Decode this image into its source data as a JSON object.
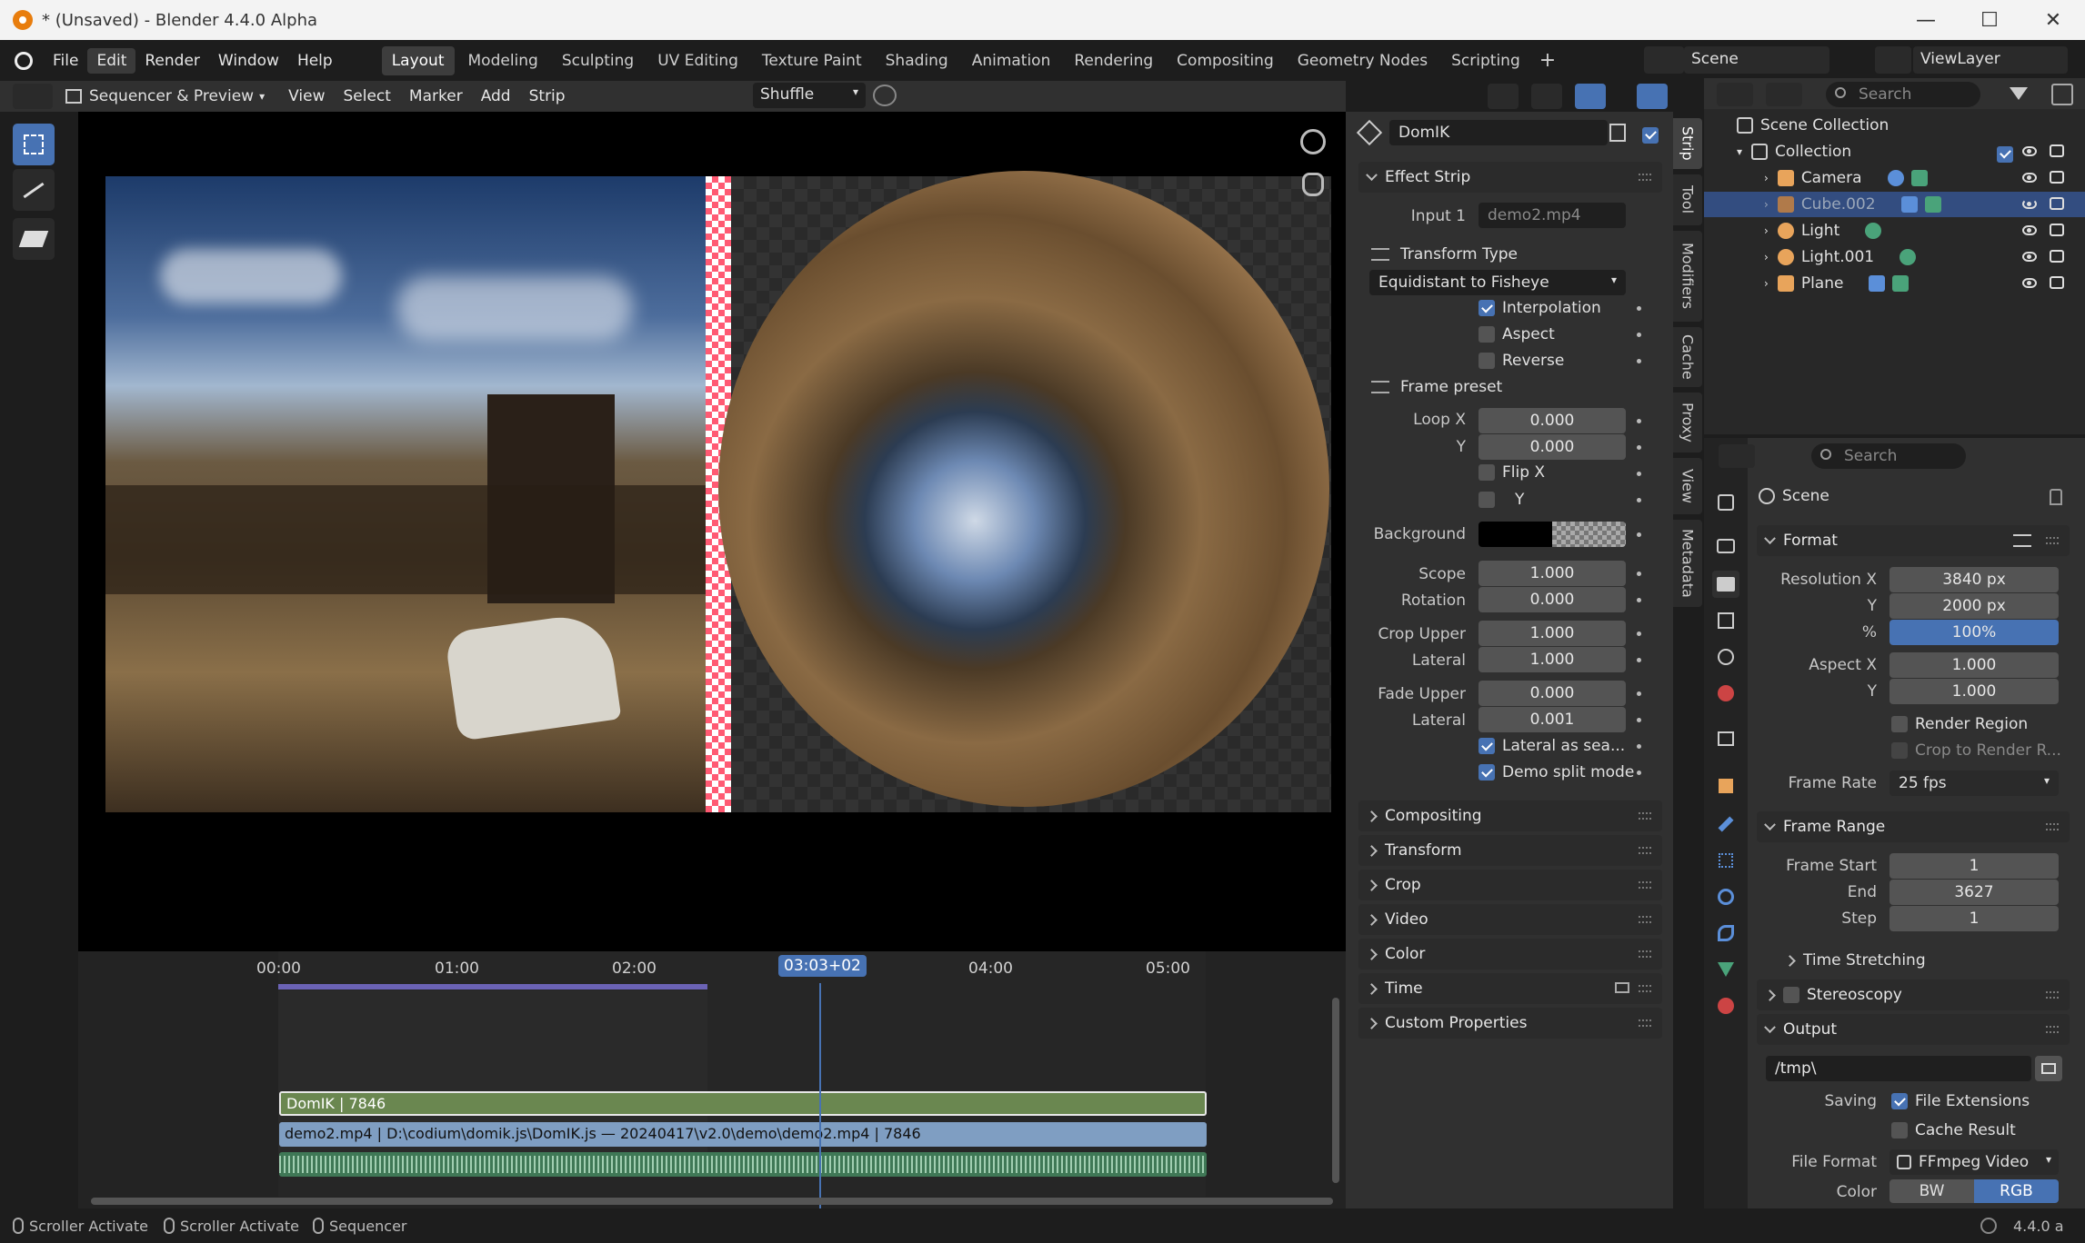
{
  "window": {
    "title": "* (Unsaved) - Blender 4.4.0 Alpha"
  },
  "menus": [
    "File",
    "Edit",
    "Render",
    "Window",
    "Help"
  ],
  "workspaces": [
    "Layout",
    "Modeling",
    "Sculpting",
    "UV Editing",
    "Texture Paint",
    "Shading",
    "Animation",
    "Rendering",
    "Compositing",
    "Geometry Nodes",
    "Scripting"
  ],
  "scene": "Scene",
  "view_layer": "ViewLayer",
  "seq_header": {
    "mode": "Sequencer & Preview",
    "menus": [
      "View",
      "Select",
      "Marker",
      "Add",
      "Strip"
    ],
    "blend": "Shuffle"
  },
  "timeline": {
    "ticks": [
      "00:00",
      "01:00",
      "02:00",
      "03:03+02",
      "04:00",
      "05:00"
    ],
    "current": "03:03+02"
  },
  "strips": {
    "effect": "DomIK | 7846",
    "movie": "demo2.mp4 | D:\\codium\\domik.js\\DomIK.js — 20240417\\v2.0\\demo\\demo2.mp4 | 7846"
  },
  "strip_panel": {
    "name": "DomIK",
    "effect_strip": "Effect Strip",
    "input1_label": "Input 1",
    "input1": "demo2.mp4",
    "transform_type_label": "Transform Type",
    "transform_type": "Equidistant to Fisheye",
    "interpolation": "Interpolation",
    "aspect": "Aspect",
    "reverse": "Reverse",
    "frame_preset": "Frame preset",
    "loop_x_label": "Loop X",
    "loop_x": "0.000",
    "loop_y_label": "Y",
    "loop_y": "0.000",
    "flip_x": "Flip X",
    "flip_y": "Y",
    "background": "Background",
    "scope_label": "Scope",
    "scope": "1.000",
    "rotation_label": "Rotation",
    "rotation": "0.000",
    "crop_upper_label": "Crop Upper",
    "crop_upper": "1.000",
    "lateral_label": "Lateral",
    "crop_lateral": "1.000",
    "fade_upper_label": "Fade Upper",
    "fade_upper": "0.000",
    "fade_lateral": "0.001",
    "lateral_seam": "Lateral as sea...",
    "demo_split": "Demo split mode",
    "sections": [
      "Compositing",
      "Transform",
      "Crop",
      "Video",
      "Color",
      "Time",
      "Custom Properties"
    ]
  },
  "side_tabs": [
    "Strip",
    "Tool",
    "Modifiers",
    "Cache",
    "Proxy",
    "View",
    "Metadata"
  ],
  "outliner": {
    "search": "Search",
    "root": "Scene Collection",
    "collection": "Collection",
    "items": [
      "Camera",
      "Cube.002",
      "Light",
      "Light.001",
      "Plane"
    ]
  },
  "properties": {
    "search": "Search",
    "scene": "Scene",
    "format": "Format",
    "res_x_label": "Resolution X",
    "res_x": "3840 px",
    "res_y_label": "Y",
    "res_y": "2000 px",
    "pct_label": "%",
    "pct": "100%",
    "aspect_x_label": "Aspect X",
    "aspect_x": "1.000",
    "aspect_y_label": "Y",
    "aspect_y": "1.000",
    "render_region": "Render Region",
    "crop_region": "Crop to Render R...",
    "frame_rate_label": "Frame Rate",
    "frame_rate": "25 fps",
    "frame_range": "Frame Range",
    "start_label": "Frame Start",
    "start": "1",
    "end_label": "End",
    "end": "3627",
    "step_label": "Step",
    "step": "1",
    "time_stretching": "Time Stretching",
    "stereoscopy": "Stereoscopy",
    "output": "Output",
    "path": "/tmp\\",
    "saving_label": "Saving",
    "file_ext": "File Extensions",
    "cache_result": "Cache Result",
    "file_format_label": "File Format",
    "file_format": "FFmpeg Video",
    "color_label": "Color",
    "bw": "BW",
    "rgb": "RGB"
  },
  "status": {
    "items": [
      "Scroller Activate",
      "Scroller Activate",
      "Sequencer"
    ],
    "version": "4.4.0 a"
  }
}
